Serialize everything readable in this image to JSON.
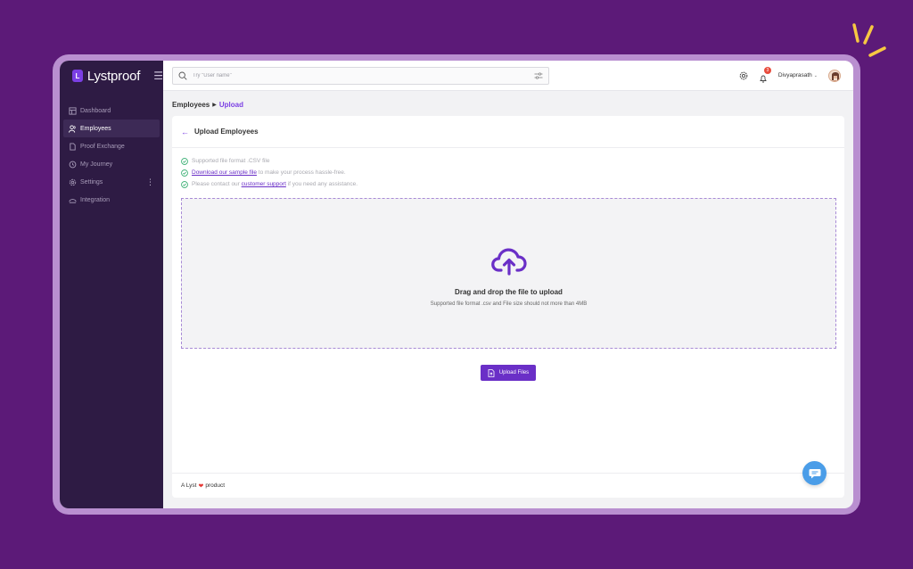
{
  "brand": {
    "name": "Lystproof",
    "logo_letter": "L"
  },
  "sidebar": {
    "items": [
      {
        "label": "Dashboard",
        "icon": "dashboard-icon",
        "active": false
      },
      {
        "label": "Employees",
        "icon": "users-icon",
        "active": true
      },
      {
        "label": "Proof Exchange",
        "icon": "document-icon",
        "active": false
      },
      {
        "label": "My Journey",
        "icon": "history-icon",
        "active": false
      },
      {
        "label": "Settings",
        "icon": "gear-icon",
        "active": false
      },
      {
        "label": "Integration",
        "icon": "integration-icon",
        "active": false
      }
    ]
  },
  "topbar": {
    "search_placeholder": "Try \"User name\"",
    "notification_count": "3",
    "user_name": "Divyaprasath"
  },
  "breadcrumb": {
    "parent": "Employees",
    "current": "Upload"
  },
  "card": {
    "title": "Upload Employees",
    "info": {
      "line1": "Supported file format .CSV file",
      "line2_link": "Download our sample file",
      "line2_rest": " to make your process hassle-free.",
      "line3_pre": "Please contact our ",
      "line3_link": "customer support",
      "line3_rest": " if you need any assistance."
    },
    "dropzone": {
      "title": "Drag and drop the file to upload",
      "subtitle": "Supported file format .csv and File size should not more than 4MB"
    },
    "upload_button": "Upload Files"
  },
  "footer": {
    "pre": "A Lyst",
    "post": "product"
  },
  "colors": {
    "accent": "#6a2fc7",
    "sidebar_bg": "#2e1b44",
    "background": "#5c1a78",
    "chat": "#4a9de8"
  }
}
